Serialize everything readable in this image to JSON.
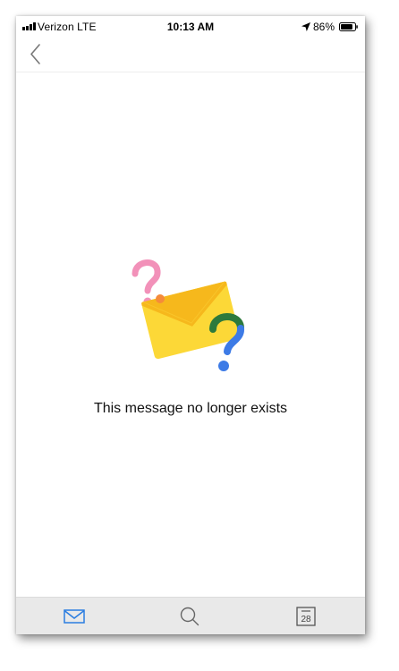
{
  "status_bar": {
    "carrier": "Verizon  LTE",
    "time": "10:13 AM",
    "battery_percent": "86%",
    "battery_level": 0.86,
    "signal_bars": 4,
    "icons": [
      "signal-icon",
      "location-arrow-icon",
      "battery-icon"
    ]
  },
  "header": {
    "back_icon": "chevron-left-icon"
  },
  "content": {
    "illustration": "envelope-question-marks-illustration",
    "message": "This message no longer exists"
  },
  "tab_bar": {
    "tabs": [
      {
        "icon": "mail-icon",
        "active": true
      },
      {
        "icon": "search-icon",
        "active": false
      },
      {
        "icon": "calendar-icon",
        "active": false,
        "day": "28"
      }
    ]
  },
  "colors": {
    "accent": "#2b7de1",
    "envelope": "#fcd837",
    "envelope_flap": "#f6b81c",
    "question_pink": "#f291b9",
    "question_blue": "#3d7be6",
    "question_green": "#2d7a3c",
    "dot_orange": "#f58b3b"
  }
}
